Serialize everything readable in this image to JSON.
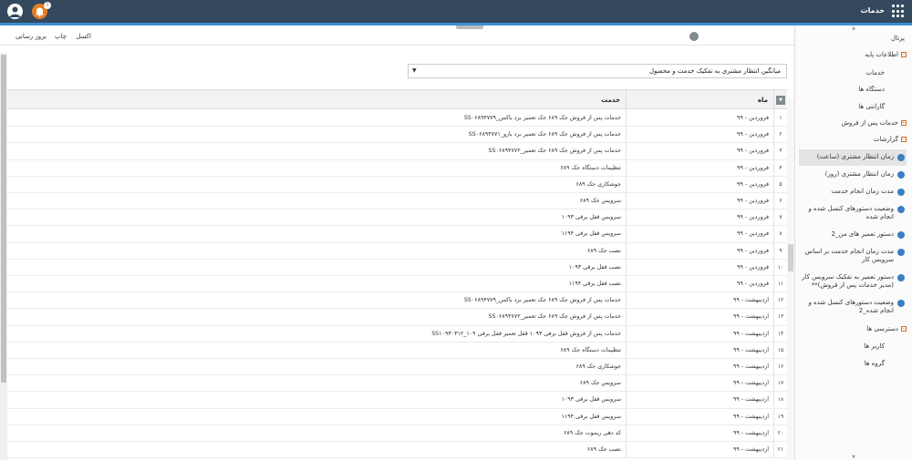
{
  "app": {
    "title": "خدمات"
  },
  "notifications": {
    "badge": "!"
  },
  "toolbar": {
    "refresh": "بروز رسانی",
    "print": "چاپ",
    "excel": "اکسل"
  },
  "filter": {
    "selected": "میانگین انتظار مشتری به تفکیک خدمت و محصول"
  },
  "table": {
    "headers": {
      "month": "ماه",
      "service": "خدمت"
    },
    "rows": [
      {
        "n": "۱",
        "month": "فروردین - ۹۹",
        "svc": "خدمات پس از فروش جک ۶۸۹ جک تعمیر برد باکس_SS۰۶۸۹۴۷۷۹"
      },
      {
        "n": "۲",
        "month": "فروردین - ۹۹",
        "svc": "خدمات پس از فروش جک ۶۸۹ جک تعمیر برد بازو_SS۰۶۸۹۴۷۷۱"
      },
      {
        "n": "۳",
        "month": "فروردین - ۹۹",
        "svc": "خدمات پس از فروش جک ۶۸۹ جک تعمیر_SS۰۶۸۹۴۷۷۲"
      },
      {
        "n": "۴",
        "month": "فروردین - ۹۹",
        "svc": "تنظیمات دستگاه جک ۶۸۹"
      },
      {
        "n": "۵",
        "month": "فروردین - ۹۹",
        "svc": "جوشکاری جک ۶۸۹"
      },
      {
        "n": "۶",
        "month": "فروردین - ۹۹",
        "svc": "سرویس جک ۶۸۹"
      },
      {
        "n": "۷",
        "month": "فروردین - ۹۹",
        "svc": "سرویس قفل برقی ۱۰۹۳"
      },
      {
        "n": "۸",
        "month": "فروردین - ۹۹",
        "svc": "سرویس قفل برقی ۱۱۹۴"
      },
      {
        "n": "۹",
        "month": "فروردین - ۹۹",
        "svc": "نصب جک ۶۸۹"
      },
      {
        "n": "۱۰",
        "month": "فروردین - ۹۹",
        "svc": "نصب قفل برقی ۱۰۹۳"
      },
      {
        "n": "۱۱",
        "month": "فروردین - ۹۹",
        "svc": "نصب قفل برقی ۱۱۹۴"
      },
      {
        "n": "۱۲",
        "month": "اردیبهشت - ۹۹",
        "svc": "خدمات پس از فروش جک ۶۸۹ جک تعمیر برد باکس_SS۰۶۸۹۴۷۷۹"
      },
      {
        "n": "۱۳",
        "month": "اردیبهشت - ۹۹",
        "svc": "خدمات پس از فروش جک ۶۸۹ جک تعمیر_SS۰۶۸۹۴۷۷۲"
      },
      {
        "n": "۱۴",
        "month": "اردیبهشت - ۹۹",
        "svc": "خدمات پس از فروش قفل برقی ۱۰۹۳ قفل تعمیر قفل برقی ۱۰۹_SS۱۰۹۳۰۳۱۲"
      },
      {
        "n": "۱۵",
        "month": "اردیبهشت - ۹۹",
        "svc": "تنظیمات دستگاه جک ۶۸۹"
      },
      {
        "n": "۱۶",
        "month": "اردیبهشت - ۹۹",
        "svc": "جوشکاری جک ۶۸۹"
      },
      {
        "n": "۱۷",
        "month": "اردیبهشت - ۹۹",
        "svc": "سرویس جک ۶۸۹"
      },
      {
        "n": "۱۸",
        "month": "اردیبهشت - ۹۹",
        "svc": "سرویس قفل برقی ۱۰۹۳"
      },
      {
        "n": "۱۹",
        "month": "اردیبهشت - ۹۹",
        "svc": "سرویس قفل برقی ۱۱۹۴"
      },
      {
        "n": "۲۰",
        "month": "اردیبهشت - ۹۹",
        "svc": "کد دهی ریموت جک ۶۸۹"
      },
      {
        "n": "۲۱",
        "month": "اردیبهشت - ۹۹",
        "svc": "نصب جک ۶۸۹"
      }
    ]
  },
  "sidebar": {
    "header": "پرتال",
    "base_info": "اطلاعات پایه",
    "base_children": [
      "خدمات",
      "دستگاه ها",
      "گارانتی ها"
    ],
    "after_sales": "خدمات پس از فروش",
    "reports": "گزارشات",
    "report_items": [
      "زمان انتظار مشتری (ساعت)",
      "زمان انتظار مشتری (روز)",
      "مدت زمان انجام خدمت",
      "وضعیت دستورهای کنسل شده و انجام شده",
      "دستور تعمیر های من_2",
      "مدت زمان انجام خدمت بر اساس سرویس کار",
      "دستور تعمیر به تفکیک سرویس کار (مدیر خدمات پس از فروش)**",
      "وضعیت دستورهای کنسل شده و انجام شده_2"
    ],
    "access": "دسترسی ها",
    "access_children": [
      "کاربر ها",
      "گروه ها"
    ]
  }
}
